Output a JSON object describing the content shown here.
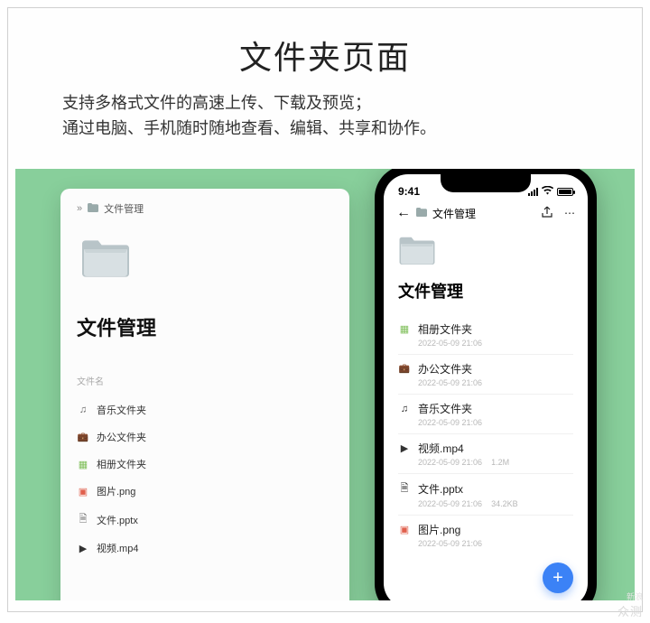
{
  "header": {
    "title": "文件夹页面",
    "desc_line1": "支持多格式文件的高速上传、下载及预览；",
    "desc_line2": "通过电脑、手机随时随地查看、编辑、共享和协作。"
  },
  "desktop": {
    "breadcrumb_icon": "folder-icon",
    "breadcrumb_label": "文件管理",
    "page_title": "文件管理",
    "column_header": "文件名",
    "items": [
      {
        "icon": "ic-music",
        "name": "音乐文件夹"
      },
      {
        "icon": "ic-briefcase",
        "name": "办公文件夹"
      },
      {
        "icon": "ic-photo",
        "name": "相册文件夹"
      },
      {
        "icon": "ic-image",
        "name": "图片.png"
      },
      {
        "icon": "ic-doc",
        "name": "文件.pptx"
      },
      {
        "icon": "ic-video",
        "name": "视频.mp4"
      }
    ]
  },
  "phone": {
    "status_time": "9:41",
    "nav_label": "文件管理",
    "page_title": "文件管理",
    "items": [
      {
        "icon": "ic-photo",
        "name": "相册文件夹",
        "date": "2022-05-09 21:06",
        "size": ""
      },
      {
        "icon": "ic-briefcase",
        "name": "办公文件夹",
        "date": "2022-05-09 21:06",
        "size": ""
      },
      {
        "icon": "ic-music",
        "name": "音乐文件夹",
        "date": "2022-05-09 21:06",
        "size": ""
      },
      {
        "icon": "ic-video",
        "name": "视频.mp4",
        "date": "2022-05-09 21:06",
        "size": "1.2M"
      },
      {
        "icon": "ic-doc",
        "name": "文件.pptx",
        "date": "2022-05-09 21:06",
        "size": "34.2KB"
      },
      {
        "icon": "ic-image",
        "name": "图片.png",
        "date": "2022-05-09 21:06",
        "size": ""
      }
    ],
    "fab_label": "+"
  },
  "watermark": {
    "main": "众测",
    "sub": "新浪"
  }
}
